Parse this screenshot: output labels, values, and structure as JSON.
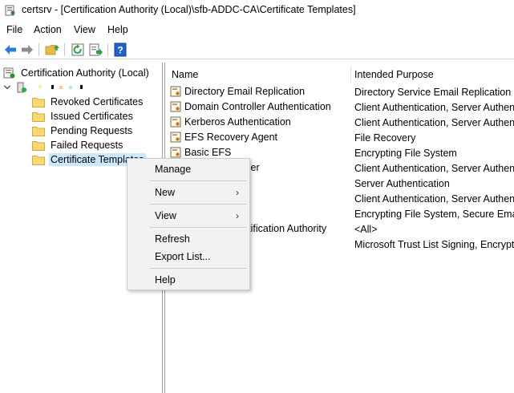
{
  "window": {
    "title": "certsrv - [Certification Authority (Local)\\sfb-ADDC-CA\\Certificate Templates]"
  },
  "menubar": {
    "items": [
      {
        "label": "File"
      },
      {
        "label": "Action"
      },
      {
        "label": "View"
      },
      {
        "label": "Help"
      }
    ]
  },
  "toolbar": {
    "icons": [
      "back-arrow-icon",
      "forward-arrow-icon",
      "up-folder-icon",
      "refresh-icon",
      "export-list-icon",
      "help-icon"
    ]
  },
  "tree": {
    "root_label": "Certification Authority (Local)",
    "children": [
      {
        "label": "Revoked Certificates"
      },
      {
        "label": "Issued Certificates"
      },
      {
        "label": "Pending Requests"
      },
      {
        "label": "Failed Requests"
      },
      {
        "label": "Certificate Templates"
      }
    ]
  },
  "list": {
    "headers": {
      "name": "Name",
      "purpose": "Intended Purpose"
    },
    "rows": [
      {
        "name": "Directory Email Replication",
        "purpose": "Directory Service Email Replication"
      },
      {
        "name": "Domain Controller Authentication",
        "purpose": "Client Authentication, Server Authenti"
      },
      {
        "name": "Kerberos Authentication",
        "purpose": "Client Authentication, Server Authenti"
      },
      {
        "name": "EFS Recovery Agent",
        "purpose": "File Recovery"
      },
      {
        "name": "Basic EFS",
        "purpose": "Encrypting File System"
      },
      {
        "name": "ller",
        "purpose": "Client Authentication, Server Authenti"
      },
      {
        "name": "",
        "purpose": "Server Authentication"
      },
      {
        "name": "",
        "purpose": "Client Authentication, Server Authenti"
      },
      {
        "name": "",
        "purpose": "Encrypting File System, Secure Email,"
      },
      {
        "name": "rtification Authority",
        "purpose": "<All>"
      },
      {
        "name": "",
        "purpose": "Microsoft Trust List Signing, Encryptin"
      }
    ]
  },
  "context_menu": {
    "manage": "Manage",
    "new": "New",
    "view": "View",
    "refresh": "Refresh",
    "export_list": "Export List...",
    "help": "Help",
    "submenu_arrow": "›"
  },
  "colors": {
    "selection": "#cce8ff",
    "menu_background": "#f2f2f2",
    "folder_yellow": "#f8d775"
  }
}
